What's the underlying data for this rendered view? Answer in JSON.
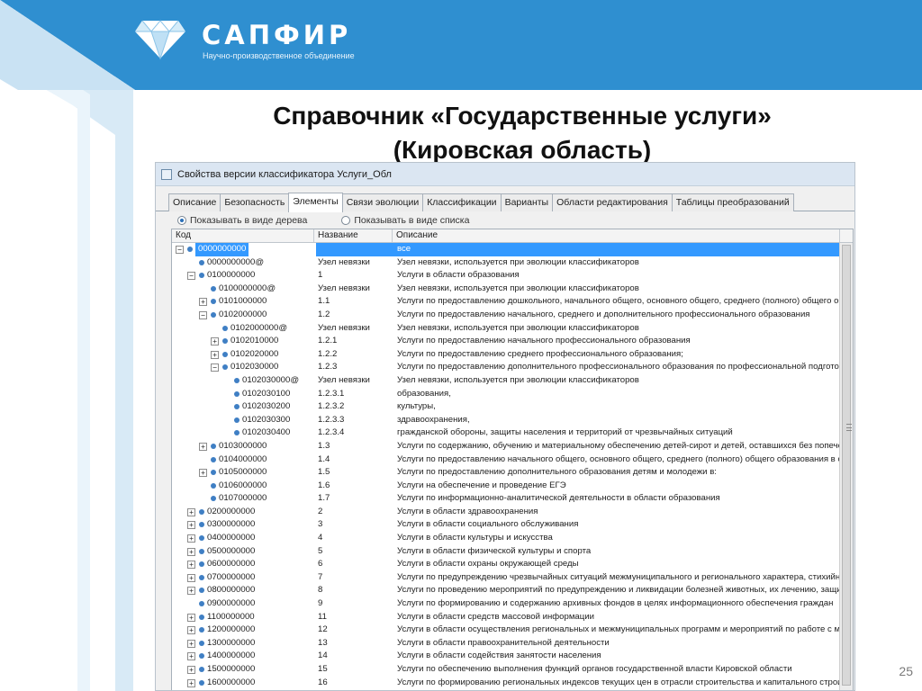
{
  "brand": {
    "name": "САПФИР",
    "subtitle": "Научно-производственное объединение"
  },
  "slide": {
    "title_line1": "Справочник «Государственные услуги»",
    "title_line2": "(Кировская область)",
    "page_number": "25"
  },
  "window": {
    "title": "Свойства версии классификатора Услуги_Обл",
    "tabs": [
      {
        "label": "Описание",
        "active": false
      },
      {
        "label": "Безопасность",
        "active": false
      },
      {
        "label": "Элементы",
        "active": true
      },
      {
        "label": "Связи эволюции",
        "active": false
      },
      {
        "label": "Классификации",
        "active": false
      },
      {
        "label": "Варианты",
        "active": false
      },
      {
        "label": "Области редактирования",
        "active": false
      },
      {
        "label": "Таблицы преобразований",
        "active": false
      }
    ],
    "view_options": {
      "tree_label": "Показывать в виде дерева",
      "list_label": "Показывать в виде списка",
      "selected": "tree"
    },
    "columns": [
      "Код",
      "Название",
      "Описание"
    ],
    "rows": [
      {
        "level": 0,
        "expander": "-",
        "code": "0000000000",
        "name": "",
        "desc": "все",
        "selected": true
      },
      {
        "level": 1,
        "expander": "",
        "code": "0000000000@",
        "name": "Узел невязки",
        "desc": "Узел невязки, используется при эволюции классификаторов"
      },
      {
        "level": 1,
        "expander": "-",
        "code": "0100000000",
        "name": "1",
        "desc": "Услуги в области образования"
      },
      {
        "level": 2,
        "expander": "",
        "code": "0100000000@",
        "name": "Узел невязки",
        "desc": "Узел невязки, используется при эволюции классификаторов"
      },
      {
        "level": 2,
        "expander": "+",
        "code": "0101000000",
        "name": "1.1",
        "desc": "Услуги по предоставлению дошкольного, начального общего, основного общего, среднего (полного) общего обр"
      },
      {
        "level": 2,
        "expander": "-",
        "code": "0102000000",
        "name": "1.2",
        "desc": "Услуги по предоставлению начального, среднего и дополнительного профессионального образования"
      },
      {
        "level": 3,
        "expander": "",
        "code": "0102000000@",
        "name": "Узел невязки",
        "desc": "Узел невязки, используется при эволюции классификаторов"
      },
      {
        "level": 3,
        "expander": "+",
        "code": "0102010000",
        "name": "1.2.1",
        "desc": "Услуги по предоставлению начального профессионального образования"
      },
      {
        "level": 3,
        "expander": "+",
        "code": "0102020000",
        "name": "1.2.2",
        "desc": "Услуги по предоставлению среднего профессионального образования;"
      },
      {
        "level": 3,
        "expander": "-",
        "code": "0102030000",
        "name": "1.2.3",
        "desc": "Услуги по предоставлению дополнительного профессионального образования по профессиональной подготовк"
      },
      {
        "level": 4,
        "expander": "",
        "code": "0102030000@",
        "name": "Узел невязки",
        "desc": "Узел невязки, используется при эволюции классификаторов"
      },
      {
        "level": 4,
        "expander": "",
        "code": "0102030100",
        "name": "1.2.3.1",
        "desc": "образования,"
      },
      {
        "level": 4,
        "expander": "",
        "code": "0102030200",
        "name": "1.2.3.2",
        "desc": "культуры,"
      },
      {
        "level": 4,
        "expander": "",
        "code": "0102030300",
        "name": "1.2.3.3",
        "desc": "здравоохранения,"
      },
      {
        "level": 4,
        "expander": "",
        "code": "0102030400",
        "name": "1.2.3.4",
        "desc": "гражданской обороны, защиты населения и территорий от чрезвычайных ситуаций"
      },
      {
        "level": 2,
        "expander": "+",
        "code": "0103000000",
        "name": "1.3",
        "desc": "Услуги по содержанию, обучению и материальному обеспечению детей-сирот и детей, оставшихся без попечени"
      },
      {
        "level": 2,
        "expander": "",
        "code": "0104000000",
        "name": "1.4",
        "desc": "Услуги по предоставлению начального общего, основного общего, среднего (полного) общего образования в сп"
      },
      {
        "level": 2,
        "expander": "+",
        "code": "0105000000",
        "name": "1.5",
        "desc": "Услуги по предоставлению дополнительного образования детям и молодежи в:"
      },
      {
        "level": 2,
        "expander": "",
        "code": "0106000000",
        "name": "1.6",
        "desc": "Услуги на обеспечение и проведение ЕГЭ"
      },
      {
        "level": 2,
        "expander": "",
        "code": "0107000000",
        "name": "1.7",
        "desc": "Услуги по информационно-аналитической деятельности в области образования"
      },
      {
        "level": 1,
        "expander": "+",
        "code": "0200000000",
        "name": "2",
        "desc": "Услуги в области здравоохранения"
      },
      {
        "level": 1,
        "expander": "+",
        "code": "0300000000",
        "name": "3",
        "desc": "Услуги в области социального обслуживания"
      },
      {
        "level": 1,
        "expander": "+",
        "code": "0400000000",
        "name": "4",
        "desc": "Услуги в области культуры и искусства"
      },
      {
        "level": 1,
        "expander": "+",
        "code": "0500000000",
        "name": "5",
        "desc": "Услуги в области физической культуры и спорта"
      },
      {
        "level": 1,
        "expander": "+",
        "code": "0600000000",
        "name": "6",
        "desc": "Услуги в области охраны окружающей среды"
      },
      {
        "level": 1,
        "expander": "+",
        "code": "0700000000",
        "name": "7",
        "desc": "Услуги по предупреждению чрезвычайных ситуаций межмуниципального и регионального характера, стихийны"
      },
      {
        "level": 1,
        "expander": "+",
        "code": "0800000000",
        "name": "8",
        "desc": "Услуги по проведению мероприятий по предупреждению и ликвидации болезней животных, их лечению, защите"
      },
      {
        "level": 1,
        "expander": "",
        "code": "0900000000",
        "name": "9",
        "desc": "Услуги по формированию и содержанию архивных фондов в целях информационного обеспечения граждан"
      },
      {
        "level": 1,
        "expander": "+",
        "code": "1100000000",
        "name": "11",
        "desc": "Услуги в области средств массовой информации"
      },
      {
        "level": 1,
        "expander": "+",
        "code": "1200000000",
        "name": "12",
        "desc": "Услуги в области осуществления региональных и межмуниципальных программ и мероприятий по работе с мол"
      },
      {
        "level": 1,
        "expander": "+",
        "code": "1300000000",
        "name": "13",
        "desc": "Услуги в области правоохранительной деятельности"
      },
      {
        "level": 1,
        "expander": "+",
        "code": "1400000000",
        "name": "14",
        "desc": "Услуги в области содействия занятости населения"
      },
      {
        "level": 1,
        "expander": "+",
        "code": "1500000000",
        "name": "15",
        "desc": "Услуги по обеспечению выполнения функций органов государственной власти Кировской области"
      },
      {
        "level": 1,
        "expander": "+",
        "code": "1600000000",
        "name": "16",
        "desc": "Услуги по формированию региональных индексов текущих цен в отрасли строительства и капитального строит"
      }
    ]
  },
  "colors": {
    "header_blue": "#2f8fd0",
    "selection_blue": "#3399ff",
    "node_blue": "#3f7fc4"
  },
  "icons": {
    "logo": "diamond-icon",
    "tree_node": "bullet-node-icon",
    "expander_plus": "plus-box-icon",
    "expander_minus": "minus-box-icon"
  }
}
